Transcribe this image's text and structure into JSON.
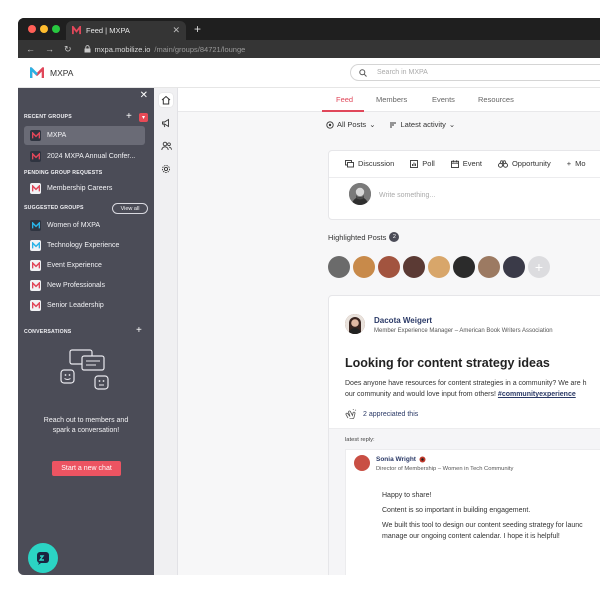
{
  "browser": {
    "tab_title": "Feed | MXPA",
    "url_host": "mxpa.mobilize.io",
    "url_path": "/main/groups/84721/lounge"
  },
  "app": {
    "brand": "MXPA",
    "search_placeholder": "Search in MXPA",
    "accent_color": "#e0475a",
    "sidebar_color": "#4b4c57"
  },
  "sidebar": {
    "recent_heading": "RECENT GROUPS",
    "recent": [
      {
        "label": "MXPA",
        "active": true
      },
      {
        "label": "2024 MXPA Annual Confer..."
      }
    ],
    "pending_heading": "PENDING GROUP REQUESTS",
    "pending": [
      {
        "label": "Membership Careers"
      }
    ],
    "suggested_heading": "SUGGESTED GROUPS",
    "view_all": "View all",
    "suggested": [
      {
        "label": "Women of MXPA"
      },
      {
        "label": "Technology Experience"
      },
      {
        "label": "Event Experience"
      },
      {
        "label": "New Professionals"
      },
      {
        "label": "Senior Leadership"
      }
    ],
    "conversations_heading": "CONVERSATIONS",
    "conversations_empty": "Reach out to members and spark a conversation!",
    "start_chat": "Start a new chat"
  },
  "nav": {
    "tabs": [
      "Feed",
      "Members",
      "Events",
      "Resources"
    ],
    "active": "Feed"
  },
  "filters": {
    "posts": "All Posts",
    "sort": "Latest activity"
  },
  "composer": {
    "tools": [
      "Discussion",
      "Poll",
      "Event",
      "Opportunity",
      "Mo"
    ],
    "placeholder": "Write something..."
  },
  "highlighted": {
    "label": "Highlighted Posts",
    "count": "2"
  },
  "post": {
    "author": "Dacota Weigert",
    "role": "Member Experience Manager – American Book Writers Association",
    "title": "Looking for content strategy ideas",
    "body_line1": "Does anyone have resources for content strategies in a community? We are h",
    "body_line2": "our community and would love input from others!",
    "hashtag": "#communityexperience",
    "appreciated": "2 appreciated this",
    "latest_reply_label": "latest reply:"
  },
  "reply": {
    "author": "Sonia Wright",
    "role": "Director of Membership – Women in Tech Community",
    "line1": "Happy to share!",
    "line2": "Content is so important in building engagement.",
    "line3": "We built this tool to design our content seeding strategy for launc",
    "line4": "manage our ongoing content calendar. I hope it is helpful!"
  }
}
